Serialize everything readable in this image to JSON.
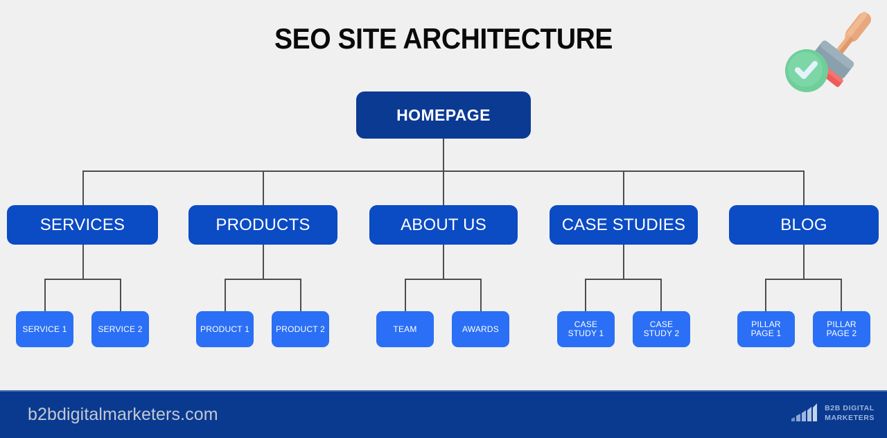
{
  "page": {
    "title": "SEO SITE ARCHITECTURE",
    "background_color": "#f0f0f0",
    "line_color": "#4d4d4d"
  },
  "colors": {
    "root_blue": "#0b3a93",
    "category_blue": "#0b4bc4",
    "leaf_blue": "#2a6ff5",
    "footer_navy": "#0a3a8f",
    "title_black": "#0a0a0a",
    "footer_text": "#c3c8d4",
    "logo_blue": "#9fb6de",
    "check_green": "#6fce9a",
    "stamp_handle": "#e8a87c",
    "stamp_body": "#8aa0ad",
    "stamp_pad": "#ef5a5a"
  },
  "diagram": {
    "root": {
      "label": "HOMEPAGE",
      "icon": "homepage-node"
    },
    "categories": [
      {
        "label": "SERVICES",
        "children": [
          {
            "line1": "SERVICE 1",
            "line2": ""
          },
          {
            "line1": "SERVICE 2",
            "line2": ""
          }
        ]
      },
      {
        "label": "PRODUCTS",
        "children": [
          {
            "line1": "PRODUCT 1",
            "line2": ""
          },
          {
            "line1": "PRODUCT 2",
            "line2": ""
          }
        ]
      },
      {
        "label": "ABOUT US",
        "children": [
          {
            "line1": "TEAM",
            "line2": ""
          },
          {
            "line1": "AWARDS",
            "line2": ""
          }
        ]
      },
      {
        "label": "CASE STUDIES",
        "children": [
          {
            "line1": "CASE",
            "line2": "STUDY 1"
          },
          {
            "line1": "CASE",
            "line2": "STUDY 2"
          }
        ]
      },
      {
        "label": "BLOG",
        "children": [
          {
            "line1": "PILLAR",
            "line2": "PAGE 1"
          },
          {
            "line1": "PILLAR",
            "line2": "PAGE 2"
          }
        ]
      }
    ]
  },
  "decoration": {
    "stamp_icon": "rubber-stamp-icon",
    "check_icon": "check-circle-icon"
  },
  "footer": {
    "url": "b2bdigitalmarketers.com",
    "logo_line1": "B2B DIGITAL",
    "logo_line2": "MARKETERS",
    "logo_icon": "bar-chart-logo-icon"
  }
}
